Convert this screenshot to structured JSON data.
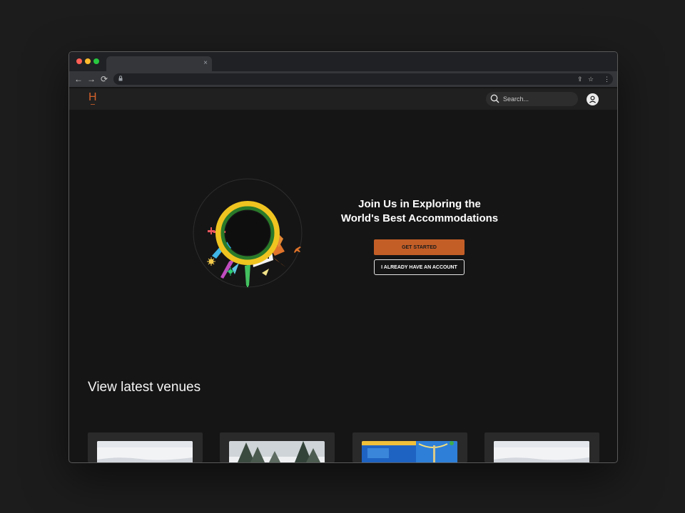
{
  "browser": {
    "tab_title": "",
    "tab_close": "×",
    "address": "",
    "nav": {
      "back": "←",
      "forward": "→",
      "reload": "⟳"
    },
    "omnibox_icons": {
      "share": "⇪",
      "star": "☆",
      "menu": "⋮"
    }
  },
  "header": {
    "logo_text": "H",
    "search": {
      "placeholder": "Search...",
      "value": ""
    }
  },
  "hero": {
    "title_line1": "Join Us in Exploring the",
    "title_line2": "World's Best Accommodations",
    "primary_button": "GET STARTED",
    "secondary_button": "I ALREADY HAVE AN ACCOUNT"
  },
  "venues": {
    "heading": "View latest venues",
    "cards": [
      {
        "thumbnail": "snowy-landscape"
      },
      {
        "thumbnail": "pine-trees"
      },
      {
        "thumbnail": "blue-building"
      },
      {
        "thumbnail": "snowy-landscape"
      }
    ]
  },
  "colors": {
    "accent": "#c45e27",
    "logo": "#d4612b",
    "page_background": "#151515",
    "header_background": "#202020"
  },
  "icons": [
    "search-icon",
    "user-icon",
    "lock-icon",
    "back-icon",
    "forward-icon",
    "reload-icon",
    "share-icon",
    "star-icon",
    "menu-icon",
    "close-icon"
  ]
}
